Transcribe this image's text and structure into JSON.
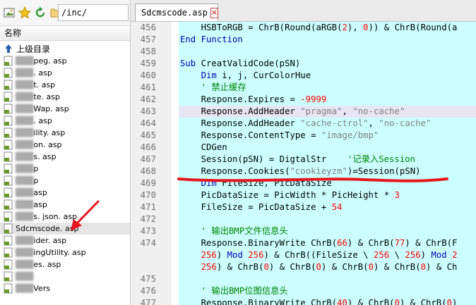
{
  "toolbar": {
    "path": "/inc/",
    "icons": [
      "image-icon",
      "star-icon",
      "refresh-icon",
      "folder-icon"
    ]
  },
  "file_panel": {
    "column_header": "名称",
    "up_label": "上级目录",
    "files": [
      "Cpeg.asp",
      "Casp.asp",
      "Chat.asp",
      "Cmute.asp",
      "CmmeWap.asp",
      "Cnt.asp",
      "Cutility.asp",
      "Cn.asp",
      "Cs.asp",
      "Cp",
      "Cp",
      "Cp.asp",
      "Cn.asp",
      "Cms.json.asp",
      "Sdcmscode.asp",
      "Cider.asp",
      "CmingUtility.asp",
      "Ces.asp",
      "C",
      "Vers"
    ],
    "visible_files": [
      "peg. asp",
      ". asp",
      "t. asp",
      "te. asp",
      "Wap. asp",
      ". asp",
      "ility. asp",
      "on. asp",
      "s. asp",
      "p",
      "p",
      "asp",
      "asp",
      "s. json. asp",
      "Sdcmscode. asp",
      "ider. asp",
      "ingUtility. asp",
      "es. asp",
      "",
      "Vers"
    ],
    "selected_index": 14
  },
  "editor": {
    "tab_label": "Sdcmscode.asp",
    "lines": [
      {
        "n": "456",
        "text": "    HSBToRGB = ChrB(Round(aRGB(2), 0)) & ChrB(Round(a"
      },
      {
        "n": "457",
        "text": "End Function"
      },
      {
        "n": "458",
        "text": ""
      },
      {
        "n": "459",
        "text": "Sub CreatValidCode(pSN)"
      },
      {
        "n": "460",
        "text": "    Dim i, j, CurColorHue"
      },
      {
        "n": "461",
        "text": "    ' 禁止缓存"
      },
      {
        "n": "462",
        "text": "    Response.Expires = -9999"
      },
      {
        "n": "463",
        "text": "    Response.AddHeader \"pragma\", \"no-cache\""
      },
      {
        "n": "464",
        "text": "    Response.AddHeader \"cache-ctrol\", \"no-cache\""
      },
      {
        "n": "465",
        "text": "    Response.ContentType = \"image/bmp\""
      },
      {
        "n": "466",
        "text": "    CDGen"
      },
      {
        "n": "467",
        "text": "    Session(pSN) = DigtalStr    '记录入Session"
      },
      {
        "n": "468",
        "text": "    Response.Cookies(\"cookieyzm\")=Session(pSN)"
      },
      {
        "n": "469",
        "text": "    Dim FileSize, PicDataSize"
      },
      {
        "n": "470",
        "text": "    PicDataSize = PicWidth * PicHeight * 3"
      },
      {
        "n": "471",
        "text": "    FileSize = PicDataSize + 54"
      },
      {
        "n": "472",
        "text": ""
      },
      {
        "n": "473",
        "text": "    ' 输出BMP文件信息头"
      },
      {
        "n": "474",
        "text": "    Response.BinaryWrite ChrB(66) & ChrB(77) & ChrB(F"
      },
      {
        "n": "",
        "text": "    256) Mod 256) & ChrB((FileSize \\ 256 \\ 256) Mod 2"
      },
      {
        "n": "",
        "text": "    256) & ChrB(0) & ChrB(0) & ChrB(0) & ChrB(0) & Ch"
      },
      {
        "n": "475",
        "text": ""
      },
      {
        "n": "476",
        "text": "    ' 输出BMP位图信息头"
      },
      {
        "n": "477",
        "text": "    Response.BinaryWrite ChrB(40) & ChrB(0) & ChrB(0)"
      }
    ]
  },
  "colors": {
    "code_bg": "#ccffff",
    "highlight_line": "#e6e6f4",
    "keyword": "#0000b0",
    "string": "#808080",
    "number": "#ff0000",
    "comment": "#008000",
    "annotation": "#e8141e"
  }
}
